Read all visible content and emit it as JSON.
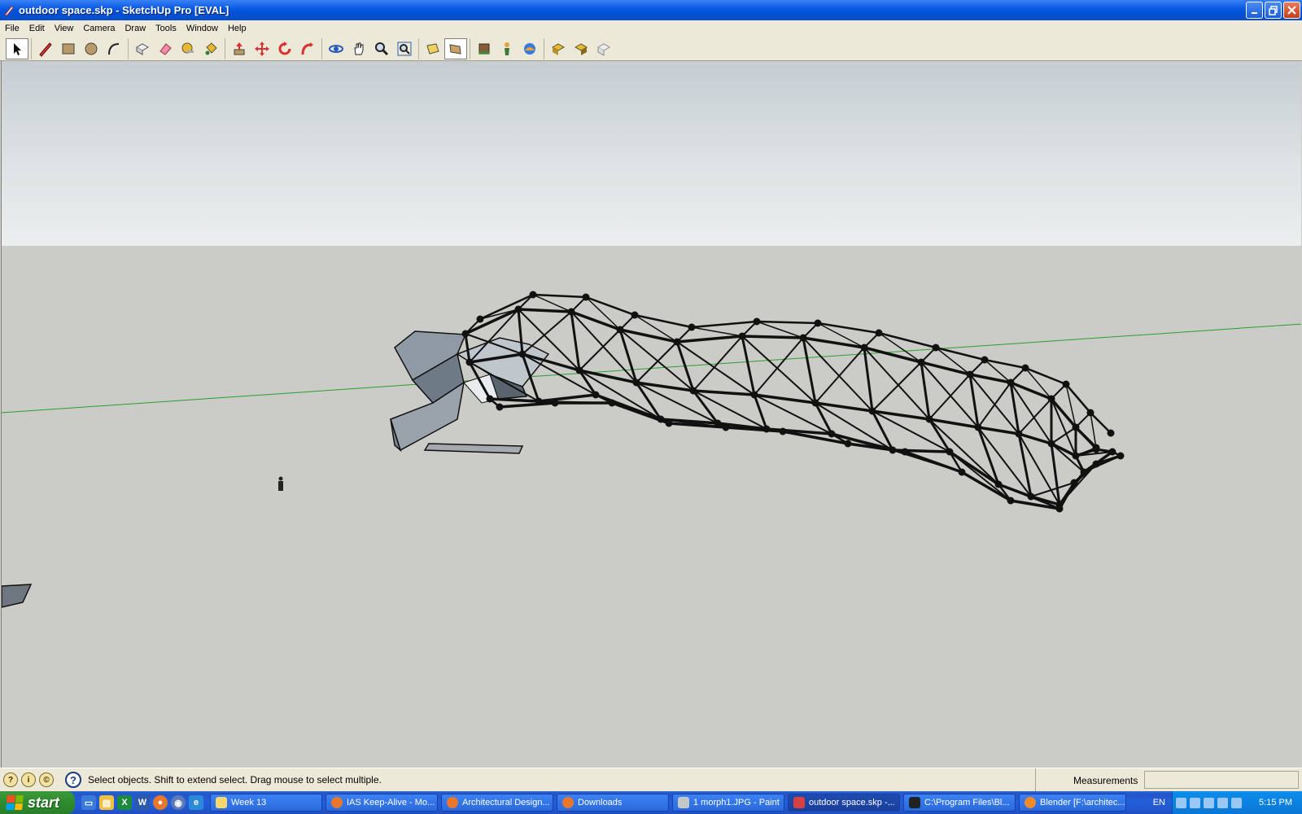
{
  "window": {
    "title": "outdoor space.skp - SketchUp Pro [EVAL]",
    "icon": "sketchup-icon"
  },
  "menu": [
    "File",
    "Edit",
    "View",
    "Camera",
    "Draw",
    "Tools",
    "Window",
    "Help"
  ],
  "toolbar": {
    "groups": [
      [
        "select-tool-icon"
      ],
      [
        "pencil-line-icon",
        "rectangle-icon",
        "circle-icon",
        "arc-icon"
      ],
      [
        "make-component-icon",
        "eraser-icon",
        "tape-measure-icon",
        "paint-bucket-icon"
      ],
      [
        "push-pull-icon",
        "move-icon",
        "rotate-icon",
        "follow-me-icon"
      ],
      [
        "orbit-icon",
        "pan-icon",
        "zoom-icon",
        "zoom-extents-icon"
      ],
      [
        "previous-view-icon",
        "next-view-icon"
      ],
      [
        "get-models-icon",
        "position-camera-icon",
        "walk-icon"
      ],
      [
        "upload-model-icon",
        "share-model-icon",
        "warehouse-icon"
      ]
    ],
    "active": "select-tool-icon"
  },
  "status": {
    "message": "Select objects. Shift to extend select. Drag mouse to select multiple.",
    "measurements_label": "Measurements",
    "measurements_value": ""
  },
  "taskbar": {
    "start_label": "start",
    "tasks": [
      {
        "label": "Week 13",
        "icon": "folder-icon",
        "color": "#f5d76e",
        "active": false
      },
      {
        "label": "IAS Keep-Alive - Mo...",
        "icon": "firefox-icon",
        "color": "#e8762b",
        "active": false
      },
      {
        "label": "Architectural Design...",
        "icon": "firefox-icon",
        "color": "#e8762b",
        "active": false
      },
      {
        "label": "Downloads",
        "icon": "firefox-icon",
        "color": "#e8762b",
        "active": false
      },
      {
        "label": "1 morph1.JPG - Paint",
        "icon": "paint-icon",
        "color": "#c7c7c7",
        "active": false
      },
      {
        "label": "outdoor space.skp -...",
        "icon": "sketchup-icon",
        "color": "#d94040",
        "active": true
      },
      {
        "label": "C:\\Program Files\\Bl...",
        "icon": "cmd-icon",
        "color": "#222222",
        "active": false
      },
      {
        "label": "Blender [F:\\architec...",
        "icon": "blender-icon",
        "color": "#f08a2a",
        "active": false
      }
    ],
    "language": "EN",
    "clock": "5:15 PM"
  }
}
